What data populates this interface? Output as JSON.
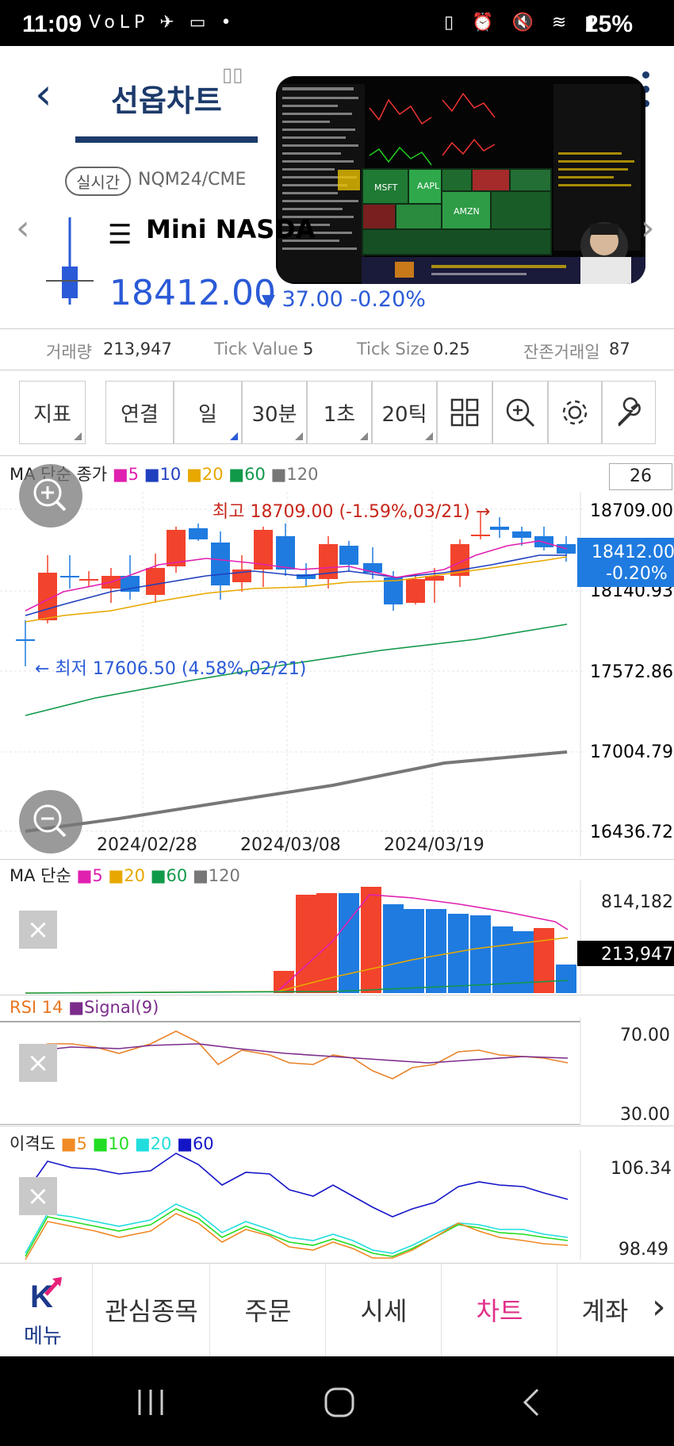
{
  "status": {
    "time": "11:09",
    "left_icons": "VoLP ✈ ▭ •",
    "battery": "25%"
  },
  "header": {
    "title": "선옵차트"
  },
  "instrument": {
    "realtime_badge": "실시간",
    "code": "NQM24/CME",
    "name": "Mini NASDA",
    "price": "18412.00",
    "change_arrow": "▼",
    "change": "37.00",
    "change_pct": "-0.20%"
  },
  "info": {
    "volume_label": "거래량",
    "volume": "213,947",
    "tick_value_label": "Tick Value",
    "tick_value": "5",
    "tick_size_label": "Tick Size",
    "tick_size": "0.25",
    "days_left_label": "잔존거래일",
    "days_left": "87"
  },
  "toolbar": {
    "indicator": "지표",
    "link": "연결",
    "day": "일",
    "min30": "30분",
    "sec1": "1초",
    "tick20": "20틱"
  },
  "main_chart": {
    "legend_prefix": "MA 단순 종가",
    "ma_periods": [
      "5",
      "10",
      "20",
      "60",
      "120"
    ],
    "ma_colors": [
      "#e020b0",
      "#1f3fbf",
      "#e8a800",
      "#11994a",
      "#777777"
    ],
    "count_box": "26",
    "y_ticks": [
      "18709.00",
      "18140.93",
      "17572.86",
      "17004.79",
      "16436.72"
    ],
    "x_ticks": [
      "2024/02/28",
      "2024/03/08",
      "2024/03/19"
    ],
    "high_note": "최고 18709.00 (-1.59%,03/21) →",
    "low_note": "← 최저 17606.50 (4.58%,02/21)",
    "price_tag_1": "18412.00",
    "price_tag_2": "-0.20%",
    "up_color": "#f2432c",
    "down_color": "#1f7be0"
  },
  "volume_chart": {
    "legend_prefix": "MA 단순",
    "ma_periods": [
      "5",
      "20",
      "60",
      "120"
    ],
    "y_ticks": [
      "814,182"
    ],
    "current": "213,947"
  },
  "rsi_chart": {
    "rsi_label": "RSI 14",
    "signal_label": "Signal(9)",
    "y_ticks": [
      "70.00",
      "30.00"
    ]
  },
  "disparity_chart": {
    "label": "이격도",
    "periods": [
      "5",
      "10",
      "20",
      "60"
    ],
    "colors": [
      "#f08a24",
      "#22dd22",
      "#22dddd",
      "#1515c8"
    ],
    "y_ticks": [
      "106.34",
      "98.49"
    ]
  },
  "bottom_nav": {
    "menu": "메뉴",
    "items": [
      "관심종목",
      "주문",
      "시세",
      "차트",
      "계좌"
    ]
  }
}
